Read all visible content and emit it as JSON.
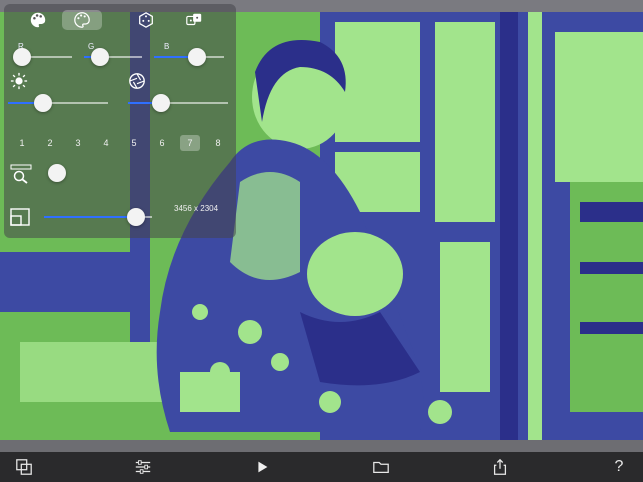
{
  "palette_tabs": [
    {
      "icon": "palette-icon",
      "selected": false
    },
    {
      "icon": "palette-outline-icon",
      "selected": true
    },
    {
      "icon": "dice-icon",
      "selected": false
    },
    {
      "icon": "dice-pair-icon",
      "selected": false
    }
  ],
  "channels": [
    {
      "label": "R",
      "value": 0.14
    },
    {
      "label": "G",
      "value": 0.28
    },
    {
      "label": "B",
      "value": 0.62
    }
  ],
  "brightness": 0.35,
  "saturation": 0.33,
  "levels": [
    "1",
    "2",
    "3",
    "4",
    "5",
    "6",
    "7",
    "8"
  ],
  "selected_level": "7",
  "zoom_level": 0.1,
  "size_slider": 0.85,
  "resolution": "3456 x 2304",
  "colors": {
    "accent": "#2f6fff",
    "toolbar_bg": "#2a2a2c",
    "photo_light": "#a2e48c",
    "photo_mid": "#6dbb57",
    "photo_dark": "#3d4aa3",
    "photo_deep": "#2b2f8a"
  },
  "toolbar": [
    {
      "name": "layers-icon"
    },
    {
      "name": "sliders-icon"
    },
    {
      "name": "play-icon"
    },
    {
      "name": "folder-icon"
    },
    {
      "name": "share-icon"
    },
    {
      "name": "help-icon",
      "label": "?"
    }
  ]
}
